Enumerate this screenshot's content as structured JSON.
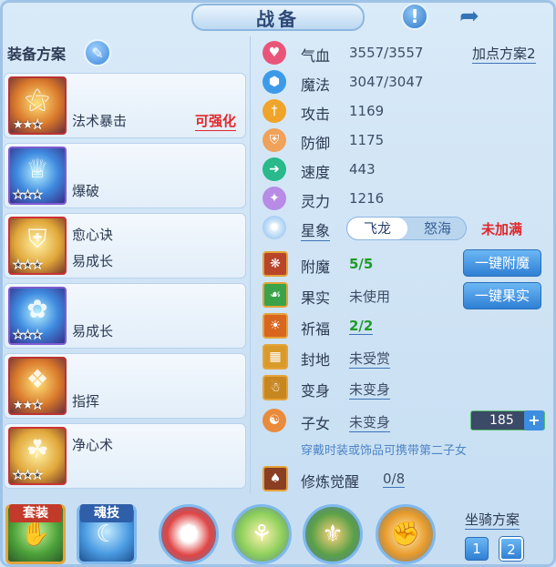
{
  "window": {
    "title": "战备"
  },
  "header": {
    "info_icon": "exclamation-icon",
    "share_icon": "share-icon"
  },
  "left": {
    "scheme_label": "装备方案",
    "edit_icon": "pencil-icon",
    "equips": [
      {
        "name": "法术暴击",
        "enhance": "可强化",
        "stars_on": 2,
        "stars_total": 3,
        "icon": "staff-icon"
      },
      {
        "name": "爆破",
        "enhance": "",
        "stars_on": 0,
        "stars_total": 3,
        "icon": "helmet-icon"
      },
      {
        "name": "愈心诀",
        "name2": "易成长",
        "enhance": "",
        "stars_on": 0,
        "stars_total": 3,
        "icon": "armor-icon"
      },
      {
        "name": "易成长",
        "enhance": "",
        "stars_on": 0,
        "stars_total": 3,
        "icon": "necklace-icon"
      },
      {
        "name": "指挥",
        "enhance": "",
        "stars_on": 2,
        "stars_total": 3,
        "icon": "belt-icon"
      },
      {
        "name": "净心术",
        "enhance": "",
        "stars_on": 0,
        "stars_total": 3,
        "icon": "boots-icon"
      }
    ]
  },
  "stats": {
    "add_scheme": "加点方案2",
    "rows": [
      {
        "label": "气血",
        "value": "3557/3557",
        "icon": "heart-icon",
        "color": "#e9557a"
      },
      {
        "label": "魔法",
        "value": "3047/3047",
        "icon": "hexagon-icon",
        "color": "#3d9ae8"
      },
      {
        "label": "攻击",
        "value": "1169",
        "icon": "sword-icon",
        "color": "#f0a52a"
      },
      {
        "label": "防御",
        "value": "1175",
        "icon": "shield-icon",
        "color": "#f0a15a"
      },
      {
        "label": "速度",
        "value": "443",
        "icon": "lightning-icon",
        "color": "#29b98a"
      },
      {
        "label": "灵力",
        "value": "1216",
        "icon": "diamond-icon",
        "color": "#b78be6"
      }
    ],
    "star": {
      "label": "星象",
      "opt_on": "飞龙",
      "opt_off": "怒海",
      "status": "未加满"
    },
    "extras": [
      {
        "label": "附魔",
        "value": "5/5",
        "green": true,
        "icon": "enchant-icon",
        "bg": "#b8442a"
      },
      {
        "label": "果实",
        "value": "未使用",
        "green": false,
        "icon": "fruit-icon",
        "bg": "#3aa34a"
      },
      {
        "label": "祈福",
        "value": "2/2",
        "green": true,
        "icon": "pray-icon",
        "bg": "#d8661f"
      },
      {
        "label": "封地",
        "value": "未受赏",
        "green": false,
        "icon": "land-icon",
        "bg": "#d99a2a"
      },
      {
        "label": "变身",
        "value": "未变身",
        "green": false,
        "icon": "transform-icon",
        "bg": "#c7861f"
      },
      {
        "label": "子女",
        "value": "未变身",
        "green": false,
        "icon": "child-icon",
        "bg": "#e98b3a"
      }
    ],
    "buttons": {
      "enchant": "一键附魔",
      "fruit": "一键果实"
    },
    "child_counter": "185",
    "hint": "穿戴时装或饰品可携带第二子女",
    "cultivate": {
      "label": "修炼觉醒",
      "value": "0/8",
      "icon": "cultivate-icon"
    }
  },
  "bottom": {
    "tabs": [
      {
        "label": "套装",
        "icon": "hand-icon"
      },
      {
        "label": "魂技",
        "icon": "dragon-icon"
      }
    ],
    "skills": [
      {
        "icon": "fan-icon"
      },
      {
        "icon": "figure-icon"
      },
      {
        "icon": "mask-icon"
      },
      {
        "icon": "punch-icon"
      }
    ],
    "mount_label": "坐骑方案",
    "mount_options": [
      "1",
      "2"
    ]
  }
}
